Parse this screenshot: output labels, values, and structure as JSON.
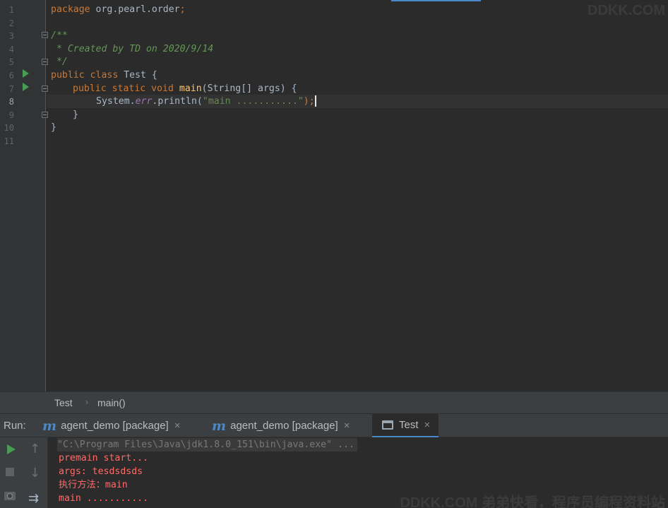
{
  "editor": {
    "line_numbers": [
      "1",
      "2",
      "3",
      "4",
      "5",
      "6",
      "7",
      "8",
      "9",
      "10",
      "11"
    ],
    "lines": {
      "l1_kw": "package",
      "l1_rest": " org.pearl.order",
      "l1_semi": ";",
      "l3": "/**",
      "l4": " * Created by TD on 2020/9/14",
      "l5": " */",
      "l6_kw": "public class",
      "l6_rest": " Test {",
      "l7_kw": "public static void",
      "l7_fn": "main",
      "l7_rest": "(String[] args) {",
      "l8_sys": "System.",
      "l8_err": "err",
      "l8_call": ".println(",
      "l8_str": "\"main ...........\"",
      "l8_end": ");",
      "l9": "}",
      "l10": "}"
    }
  },
  "breadcrumb": {
    "items": [
      "Test",
      "main()"
    ],
    "separator": "›"
  },
  "run_panel": {
    "label": "Run:",
    "tabs": [
      {
        "label": "agent_demo [package]",
        "icon": "maven-icon"
      },
      {
        "label": "agent_demo [package]",
        "icon": "maven-icon"
      },
      {
        "label": "Test",
        "icon": "console-icon"
      }
    ],
    "close_glyph": "×",
    "toolbar": {
      "up_glyph": "↑",
      "down_glyph": "↓",
      "wrap_glyph": "⇉"
    },
    "console": [
      "\"C:\\Program Files\\Java\\jdk1.8.0_151\\bin\\java.exe\" ...",
      "premain start...",
      "args: tesdsdsds",
      "执行方法：main",
      "main ..........."
    ]
  },
  "watermarks": {
    "top": "DDKK.COM",
    "bottom": "DDKK.COM 弟弟快看，程序员编程资料站"
  },
  "colors": {
    "accent": "#4a88c7",
    "run_green": "#499c54",
    "keyword": "#cc7832",
    "comment": "#629755",
    "error_output": "#ff6b68"
  }
}
